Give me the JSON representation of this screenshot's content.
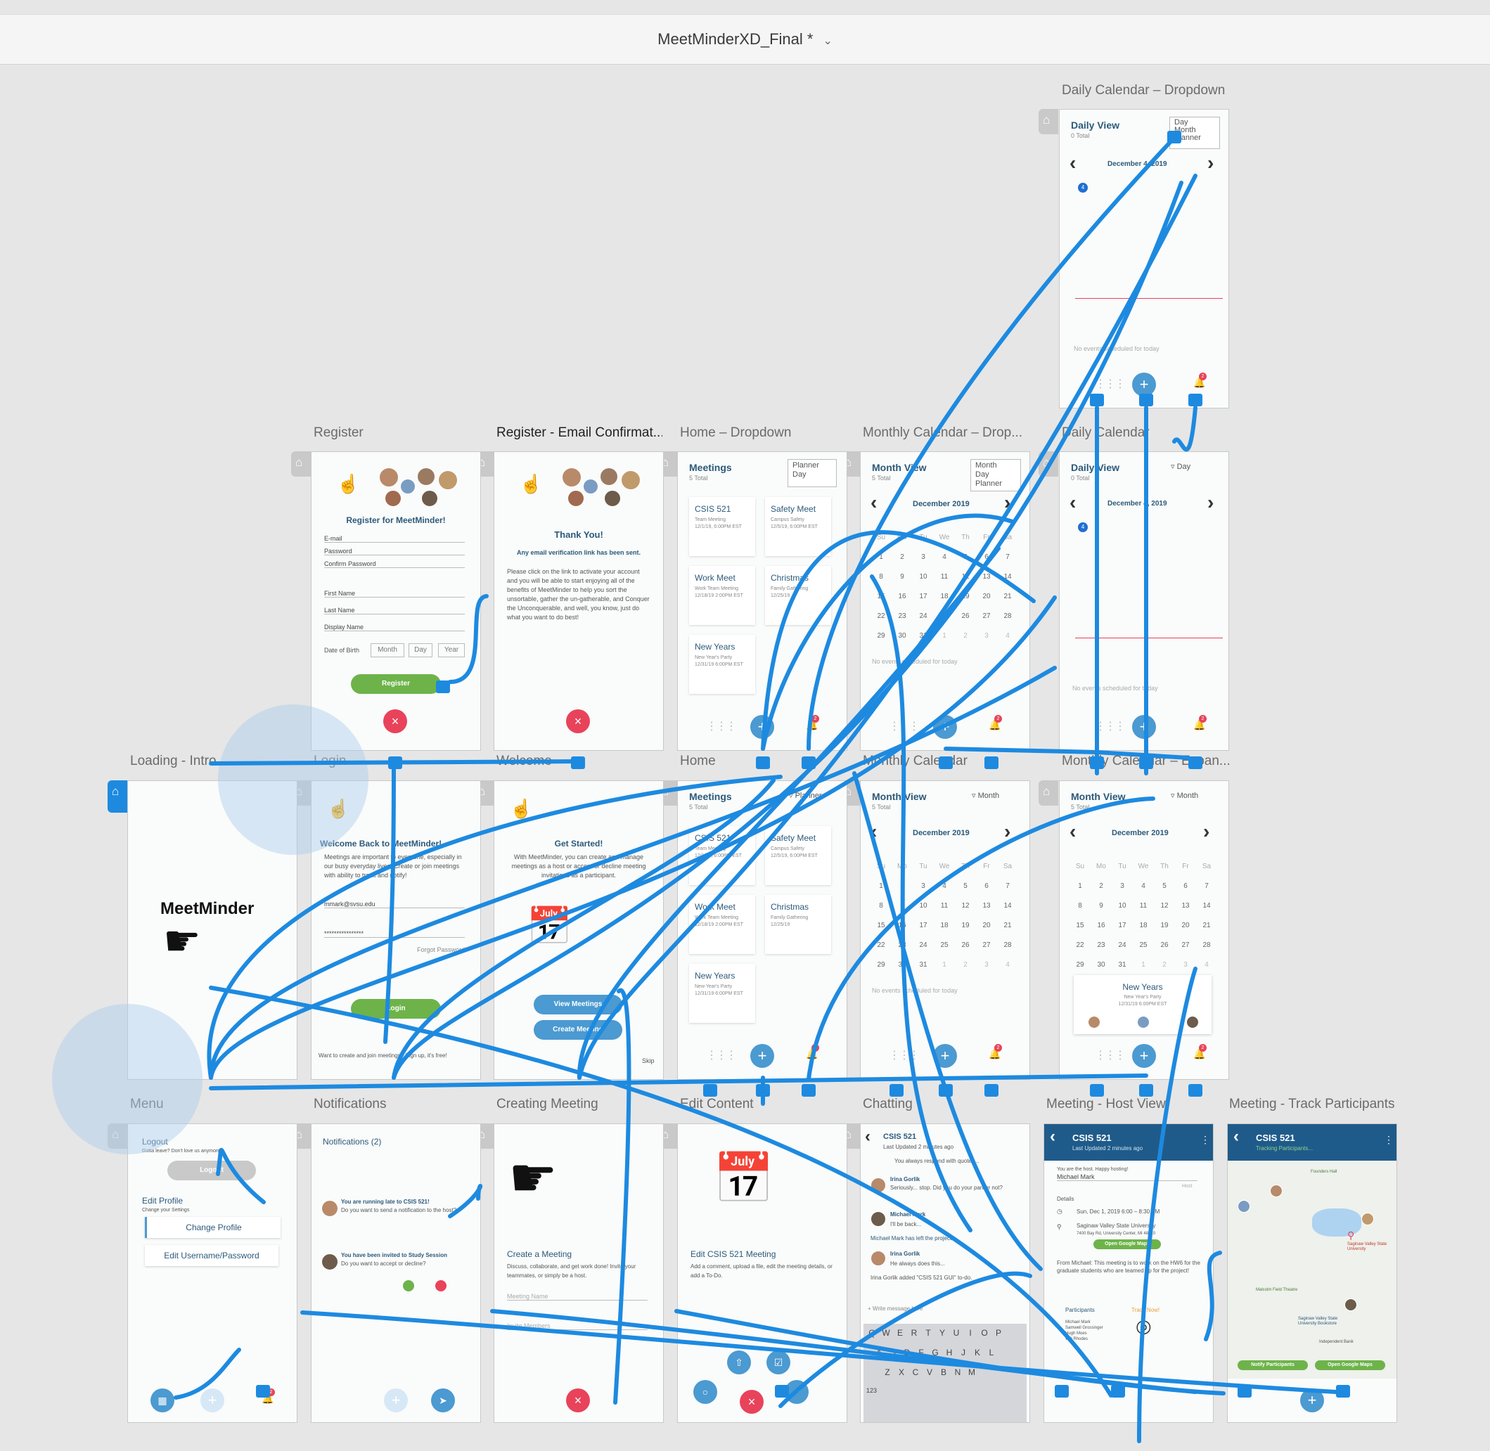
{
  "document": {
    "title": "MeetMinderXD_Final *"
  },
  "artboards": {
    "daily_dropdown": {
      "label": "Daily Calendar – Dropdown",
      "title": "Daily View",
      "sub": "0 Total",
      "date": "December 4, 2019",
      "options": [
        "Day",
        "Month",
        "Planner"
      ],
      "empty": "No events scheduled for today",
      "badge": "4",
      "bell_count": "2"
    },
    "register": {
      "label": "Register",
      "heading": "Register for MeetMinder!",
      "fields": [
        "E-mail",
        "Password",
        "Confirm Password",
        "First Name",
        "Last Name",
        "Display Name",
        "Date of Birth"
      ],
      "dob": [
        "Month",
        "Day",
        "Year"
      ],
      "button": "Register"
    },
    "register_confirm": {
      "label": "Register - Email Confirmat...",
      "heading": "Thank You!",
      "line1": "Any email verification link has been sent.",
      "body": "Please click on the link to activate your account and you will be able to start enjoying all of the benefits of MeetMinder to help you sort the unsortable, gather the un-gatherable, and Conquer the Unconquerable, and well, you know, just do what you want to do best!"
    },
    "home_dropdown": {
      "label": "Home – Dropdown",
      "title": "Meetings",
      "sub": "5 Total",
      "options": [
        "Planner",
        "Day"
      ],
      "cards": [
        {
          "title": "CSIS 521",
          "sub": "Team Meeting",
          "time": "12/1/19, 6:00PM EST"
        },
        {
          "title": "Safety Meet",
          "sub": "Campus Safety",
          "time": "12/5/19, 6:00PM EST"
        },
        {
          "title": "Work Meet",
          "sub": "Work Team Meeting",
          "time": "12/18/19 2:00PM EST"
        },
        {
          "title": "Christmas",
          "sub": "Family Gathering",
          "time": "12/25/19"
        },
        {
          "title": "New Years",
          "sub": "New Year's Party",
          "time": "12/31/19 6:00PM EST"
        }
      ],
      "bell_count": "2"
    },
    "monthly_dropdown": {
      "label": "Monthly Calendar – Drop...",
      "title": "Month View",
      "sub": "5 Total",
      "month": "December 2019",
      "options": [
        "Month",
        "Day",
        "Planner"
      ],
      "weekdays": [
        "Su",
        "Mo",
        "Tu",
        "We",
        "Th",
        "Fr",
        "Sa"
      ],
      "days": [
        "1",
        "2",
        "3",
        "4",
        "5",
        "6",
        "7",
        "8",
        "9",
        "10",
        "11",
        "12",
        "13",
        "14",
        "15",
        "16",
        "17",
        "18",
        "19",
        "20",
        "21",
        "22",
        "23",
        "24",
        "25",
        "26",
        "27",
        "28",
        "29",
        "30",
        "31",
        "1",
        "2",
        "3",
        "4"
      ],
      "empty": "No events scheduled for today",
      "bell_count": "2"
    },
    "daily": {
      "label": "Daily Calendar",
      "title": "Daily View",
      "sub": "0 Total",
      "date": "December 4, 2019",
      "option": "Day",
      "empty": "No events scheduled for today",
      "badge": "4",
      "bell_count": "2"
    },
    "loading": {
      "label": "Loading - Intro",
      "logo": "MeetMinder"
    },
    "login": {
      "label": "Login",
      "heading": "Welcome Back to MeetMinder!",
      "body": "Meetings are important to everyone, especially in our busy everyday lives. Create or join meetings with ability to track and notify!",
      "email": "mmark@svsu.edu",
      "password": "****************",
      "forgot": "Forgot Password?",
      "button": "Login",
      "footer": "Want to create and join meetings? Sign up, it's free!"
    },
    "welcome": {
      "label": "Welcome",
      "heading": "Get Started!",
      "body": "With MeetMinder, you can create and manage meetings as a host or accept or decline meeting invitations as a participant.",
      "btn_view": "View Meetings",
      "btn_create": "Create Meeting",
      "skip": "Skip"
    },
    "home": {
      "label": "Home",
      "title": "Meetings",
      "sub": "5 Total",
      "option": "Planner",
      "bell_count": "2"
    },
    "monthly": {
      "label": "Monthly Calendar",
      "title": "Month View",
      "sub": "5 Total",
      "month": "December 2019",
      "option": "Month",
      "empty": "No events scheduled for today",
      "bell_count": "2"
    },
    "monthly_expanded": {
      "label": "Monthly Calendar – Expan...",
      "title": "Month View",
      "sub": "5 Total",
      "month": "December 2019",
      "option": "Month",
      "event_title": "New Years",
      "event_sub": "New Year's Party",
      "event_time": "12/31/19 6:00PM EST",
      "bell_count": "2"
    },
    "menu": {
      "label": "Menu",
      "logout_title": "Logout",
      "logout_sub": "Gotta leave? Don't love us anymore?",
      "logout_btn": "Logout",
      "edit_title": "Edit Profile",
      "edit_sub": "Change your Settings",
      "btn_profile": "Change Profile",
      "btn_user": "Edit Username/Password",
      "bell_count": "2"
    },
    "notifications": {
      "label": "Notifications",
      "heading": "Notifications (2)",
      "n1_title": "You are running late to CSIS 521!",
      "n1_body": "Do you want to send a notification to the host?",
      "n2_title": "You have been invited to Study Session",
      "n2_body": "Do you want to accept or decline?"
    },
    "creating": {
      "label": "Creating Meeting",
      "heading": "Create a Meeting",
      "body": "Discuss, collaborate, and get work done! Invite your teammates, or simply be a host.",
      "f1": "Meeting Name",
      "f2": "Invite Members"
    },
    "edit": {
      "label": "Edit Content",
      "heading": "Edit CSIS 521 Meeting",
      "body": "Add a comment, upload a file, edit the meeting details, or add a To-Do."
    },
    "chatting": {
      "label": "Chatting",
      "title": "CSIS 521",
      "sub": "Last Updated 2 minutes ago",
      "m0": "You always respond with quotes...",
      "m1_name": "Irina Gorlik",
      "m1": "Seriously... stop. Did you do your part or not?",
      "m2_name": "Michael Mark",
      "m2": "I'll be back...",
      "sys": "Michael Mark has left the project",
      "m3_name": "Irina Gorlik",
      "m3": "He always does this...",
      "todo": "Irina Gorlik added \"CSIS 521 GUI\" to-do.",
      "input": "Write message here",
      "keys1": [
        "Q",
        "W",
        "E",
        "R",
        "T",
        "Y",
        "U",
        "I",
        "O",
        "P"
      ],
      "keys2": [
        "A",
        "S",
        "D",
        "F",
        "G",
        "H",
        "J",
        "K",
        "L"
      ],
      "keys3": [
        "Z",
        "X",
        "C",
        "V",
        "B",
        "N",
        "M"
      ],
      "k123": "123"
    },
    "host": {
      "label": "Meeting - Host View",
      "title": "CSIS 521",
      "sub": "Last Updated 2 minutes ago",
      "intro": "You are the host. Happy hosting!",
      "host_name": "Michael Mark",
      "host_tag": "Host",
      "details": "Details",
      "date": "Sun, Dec 1, 2019 6:00 – 8:30 PM",
      "place": "Saginaw Valley State University",
      "addr": "7400 Bay Rd, University Center, MI 48710",
      "maps_btn": "Open Google Maps",
      "from": "From Michael: This meeting is to work on the HW6 for the graduate students who are teamed up for the project!",
      "participants": "Participants",
      "names": [
        "Michael Mark",
        "Samwell Grossinger",
        "Hugh Moes",
        "Will Rhodes"
      ],
      "track": "Track Now!"
    },
    "track": {
      "label": "Meeting - Track Participants",
      "title": "CSIS 521",
      "sub": "Tracking Participants...",
      "btn1": "Notify Participants",
      "btn2": "Open Google Maps",
      "places": [
        "Founders Hall",
        "Saginaw Valley State University",
        "Malcolm Field Theatre",
        "Saginaw Valley State University Bookstore",
        "Independent Bank"
      ]
    }
  }
}
